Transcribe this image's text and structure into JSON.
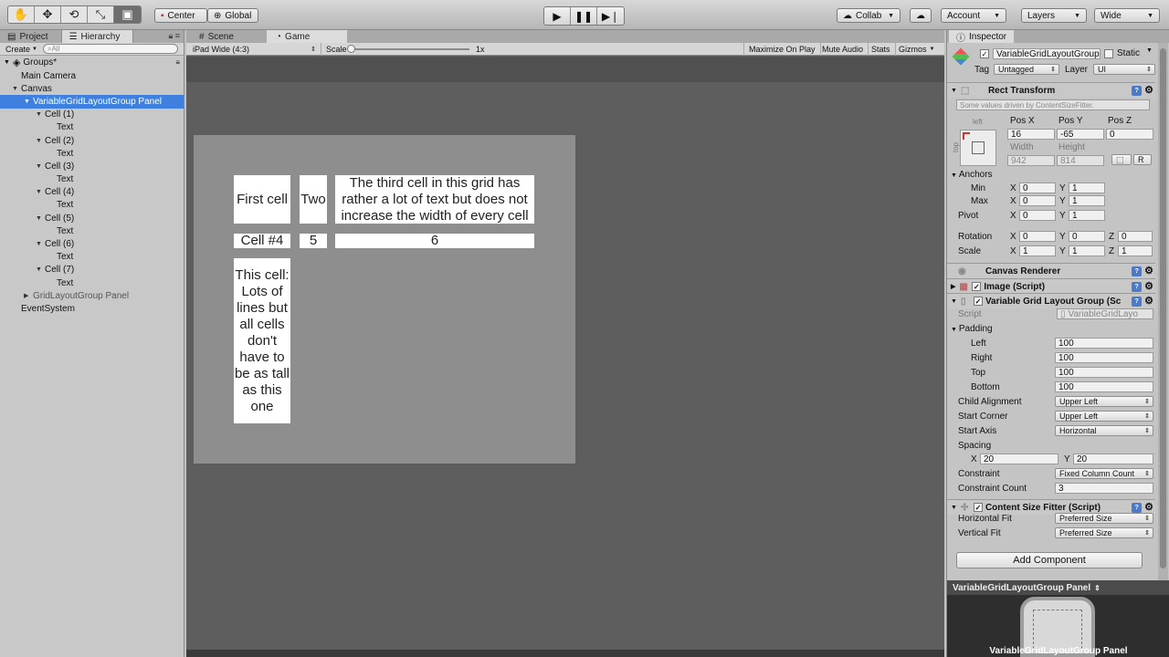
{
  "toolbar": {
    "tools": [
      "hand-icon",
      "move-icon",
      "rotate-icon",
      "scale-icon",
      "rect-icon"
    ],
    "pivot_label": "Center",
    "space_label": "Global",
    "collab_label": "Collab",
    "account_label": "Account",
    "layers_label": "Layers",
    "layout_label": "Wide"
  },
  "left": {
    "tab_project": "Project",
    "tab_hierarchy": "Hierarchy",
    "create_label": "Create",
    "search_placeholder": "All",
    "scene_name": "Groups*",
    "items": [
      {
        "label": "Main Camera",
        "indent": 1,
        "arrow": ""
      },
      {
        "label": "Canvas",
        "indent": 1,
        "arrow": "▼"
      },
      {
        "label": "VariableGridLayoutGroup Panel",
        "indent": 2,
        "arrow": "▼",
        "selected": true
      },
      {
        "label": "Cell (1)",
        "indent": 3,
        "arrow": "▼"
      },
      {
        "label": "Text",
        "indent": 4,
        "arrow": ""
      },
      {
        "label": "Cell (2)",
        "indent": 3,
        "arrow": "▼"
      },
      {
        "label": "Text",
        "indent": 4,
        "arrow": ""
      },
      {
        "label": "Cell (3)",
        "indent": 3,
        "arrow": "▼"
      },
      {
        "label": "Text",
        "indent": 4,
        "arrow": ""
      },
      {
        "label": "Cell (4)",
        "indent": 3,
        "arrow": "▼"
      },
      {
        "label": "Text",
        "indent": 4,
        "arrow": ""
      },
      {
        "label": "Cell (5)",
        "indent": 3,
        "arrow": "▼"
      },
      {
        "label": "Text",
        "indent": 4,
        "arrow": ""
      },
      {
        "label": "Cell (6)",
        "indent": 3,
        "arrow": "▼"
      },
      {
        "label": "Text",
        "indent": 4,
        "arrow": ""
      },
      {
        "label": "Cell (7)",
        "indent": 3,
        "arrow": "▼"
      },
      {
        "label": "Text",
        "indent": 4,
        "arrow": ""
      },
      {
        "label": "GridLayoutGroup Panel",
        "indent": 2,
        "arrow": "▶",
        "dim": true
      },
      {
        "label": "EventSystem",
        "indent": 1,
        "arrow": ""
      }
    ]
  },
  "center": {
    "tab_scene": "Scene",
    "tab_game": "Game",
    "resolution": "iPad Wide (4:3)",
    "scale_label": "Scale",
    "scale_value": "1x",
    "maximize": "Maximize On Play",
    "mute": "Mute Audio",
    "stats": "Stats",
    "gizmos": "Gizmos",
    "cells": [
      "First cell",
      "Two",
      "The third cell in this grid has rather a lot of text but does not increase the width of every cell",
      "Cell #4",
      "5",
      "6",
      "This cell: Lots of lines but all cells don't have to be as tall as this one"
    ]
  },
  "inspector": {
    "tab_label": "Inspector",
    "object_name": "VariableGridLayoutGroup",
    "static_label": "Static",
    "tag_label": "Tag",
    "tag_value": "Untagged",
    "layer_label": "Layer",
    "layer_value": "UI",
    "rect_transform": {
      "title": "Rect Transform",
      "note": "Some values driven by ContentSizeFitter.",
      "anchor_h": "left",
      "anchor_v": "top",
      "posx_label": "Pos X",
      "posy_label": "Pos Y",
      "posz_label": "Pos Z",
      "posx": "16",
      "posy": "-65",
      "posz": "0",
      "width_label": "Width",
      "height_label": "Height",
      "width": "942",
      "height": "814",
      "r_btn": "R",
      "anchors_label": "Anchors",
      "min_label": "Min",
      "max_label": "Max",
      "min_x": "0",
      "min_y": "1",
      "max_x": "0",
      "max_y": "1",
      "pivot_label": "Pivot",
      "pivot_x": "0",
      "pivot_y": "1",
      "rotation_label": "Rotation",
      "rot_x": "0",
      "rot_y": "0",
      "rot_z": "0",
      "scale_label": "Scale",
      "scale_x": "1",
      "scale_y": "1",
      "scale_z": "1",
      "x": "X",
      "y": "Y",
      "z": "Z"
    },
    "canvas_renderer": "Canvas Renderer",
    "image_script": "Image (Script)",
    "vglg": {
      "title": "Variable Grid Layout Group (Sc",
      "script_label": "Script",
      "script_value": "VariableGridLayo",
      "padding_label": "Padding",
      "left_label": "Left",
      "left": "100",
      "right_label": "Right",
      "right": "100",
      "top_label": "Top",
      "top": "100",
      "bottom_label": "Bottom",
      "bottom": "100",
      "child_alignment_label": "Child Alignment",
      "child_alignment": "Upper Left",
      "start_corner_label": "Start Corner",
      "start_corner": "Upper Left",
      "start_axis_label": "Start Axis",
      "start_axis": "Horizontal",
      "spacing_label": "Spacing",
      "spacing_x": "20",
      "spacing_y": "20",
      "constraint_label": "Constraint",
      "constraint": "Fixed Column Count",
      "constraint_count_label": "Constraint Count",
      "constraint_count": "3"
    },
    "csf": {
      "title": "Content Size Fitter (Script)",
      "hfit_label": "Horizontal Fit",
      "hfit": "Preferred Size",
      "vfit_label": "Vertical Fit",
      "vfit": "Preferred Size"
    },
    "add_component": "Add Component",
    "preview_title": "VariableGridLayoutGroup Panel",
    "preview_label": "VariableGridLayoutGroup Panel"
  },
  "colors": {
    "selection": "#3d80df",
    "game_panel": "#8e8e8e",
    "game_bg": "#5e5e5e"
  }
}
